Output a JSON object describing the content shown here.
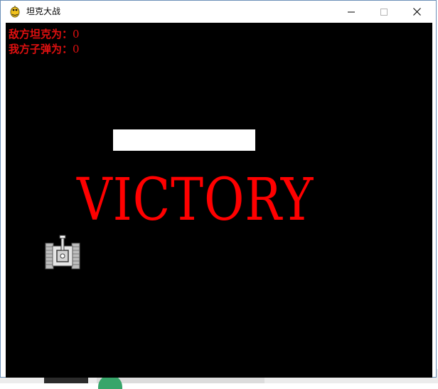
{
  "window": {
    "title": "坦克大战",
    "icon": "pygame-snake-icon",
    "controls": [
      "minimize-icon",
      "maximize-icon",
      "close-icon"
    ]
  },
  "hud": {
    "enemy_tanks_label": "敌方坦克为：",
    "enemy_tanks_count": "0",
    "my_bullets_label": "我方子弹为：",
    "my_bullets_count": "0",
    "color": "#e01010"
  },
  "game": {
    "background": "#000000",
    "message": "VICTORY",
    "message_color": "#ff0000",
    "wall_color": "#ffffff",
    "player_tank_icon": "player-tank-icon"
  }
}
